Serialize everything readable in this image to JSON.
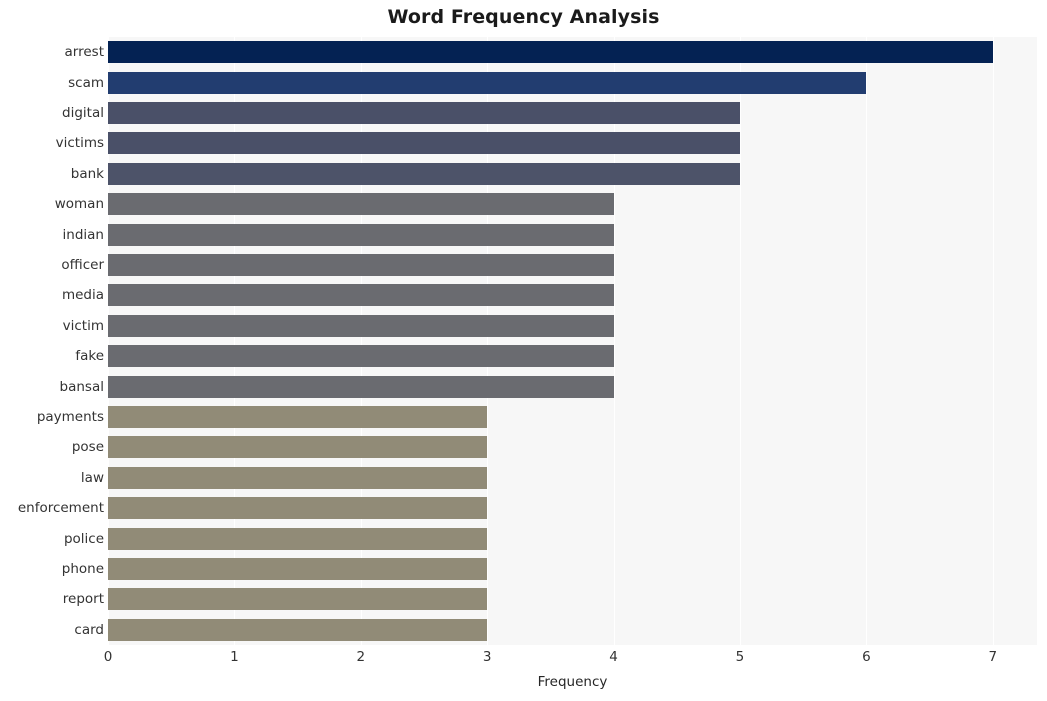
{
  "chart_data": {
    "type": "bar",
    "orientation": "horizontal",
    "title": "Word Frequency Analysis",
    "xlabel": "Frequency",
    "ylabel": "",
    "xlim": [
      0,
      7.35
    ],
    "xticks": [
      0,
      1,
      2,
      3,
      4,
      5,
      6,
      7
    ],
    "xticklabels": [
      "0",
      "1",
      "2",
      "3",
      "4",
      "5",
      "6",
      "7"
    ],
    "grid": true,
    "grid_axis": "x",
    "grid_color": "#ffffff",
    "plot_background": "#f7f7f7",
    "figure_background": "#ffffff",
    "legend": null,
    "categories": [
      "arrest",
      "scam",
      "digital",
      "victims",
      "bank",
      "woman",
      "indian",
      "officer",
      "media",
      "victim",
      "fake",
      "bansal",
      "payments",
      "pose",
      "law",
      "enforcement",
      "police",
      "phone",
      "report",
      "card"
    ],
    "values": [
      7,
      6,
      5,
      5,
      5,
      4,
      4,
      4,
      4,
      4,
      4,
      4,
      3,
      3,
      3,
      3,
      3,
      3,
      3,
      3
    ],
    "bar_colors": [
      "#042253",
      "#223d70",
      "#4a5068",
      "#4a5068",
      "#4d5369",
      "#6a6b70",
      "#6a6b70",
      "#6a6b70",
      "#6a6b70",
      "#6a6b70",
      "#6a6b70",
      "#6a6b70",
      "#918b77",
      "#918b77",
      "#918b77",
      "#918b77",
      "#918b77",
      "#918b77",
      "#918b77",
      "#918b77"
    ]
  }
}
